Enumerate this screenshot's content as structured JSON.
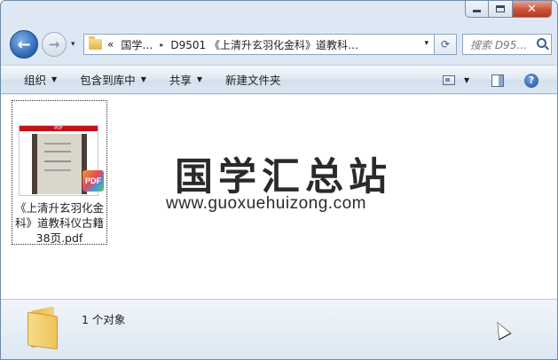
{
  "window": {
    "caption_buttons": {
      "minimize": "minimize-icon",
      "maximize": "maximize-icon",
      "close": "close-icon",
      "close_glyph": "✕"
    }
  },
  "nav": {
    "back_glyph": "←",
    "forward_glyph": "→",
    "history_glyph": "▾",
    "address": {
      "overflow_glyph": "«",
      "segments": [
        "国学…",
        "D9501 《上清升玄羽化金科》道教科…"
      ],
      "separator_glyph": "▸",
      "dropdown_glyph": "▾"
    },
    "refresh_glyph": "⟳",
    "search": {
      "placeholder": "搜索 D95…"
    }
  },
  "toolbar": {
    "organize": "组织",
    "include_in_library": "包含到库中",
    "share": "共享",
    "new_folder": "新建文件夹",
    "caret": "▼",
    "help_glyph": "?"
  },
  "content": {
    "file": {
      "name": "《上清升玄羽化金科》道教科仪古籍38页.pdf",
      "name_line1": "《上清升玄羽化金",
      "name_line2": "科》道教科仪古籍",
      "name_line3": "38页.pdf",
      "thumb_banner": "PDF",
      "badge": "PDF"
    },
    "watermark": {
      "title": "国学汇总站",
      "url": "www.guoxuehuizong.com"
    }
  },
  "details": {
    "item_count": "1 个对象"
  }
}
